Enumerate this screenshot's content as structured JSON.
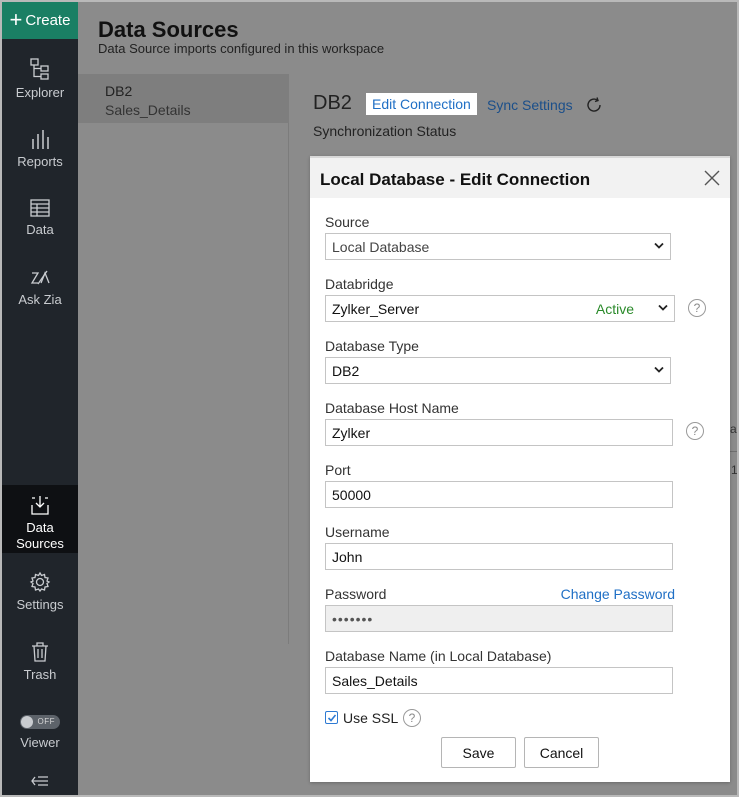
{
  "sidebar": {
    "create_label": "Create",
    "items": [
      {
        "label": "Explorer",
        "icon": "explorer-icon"
      },
      {
        "label": "Reports",
        "icon": "reports-icon"
      },
      {
        "label": "Data",
        "icon": "data-table-icon"
      },
      {
        "label": "Ask Zia",
        "icon": "ask-zia-icon"
      },
      {
        "label_line1": "Data",
        "label_line2": "Sources",
        "icon": "data-sources-icon",
        "active": true
      },
      {
        "label": "Settings",
        "icon": "gear-icon"
      },
      {
        "label": "Trash",
        "icon": "trash-icon"
      },
      {
        "label": "Viewer",
        "toggle_text": "OFF"
      }
    ],
    "collapse_icon": "collapse-icon"
  },
  "page": {
    "title": "Data Sources",
    "subtitle": "Data Source imports configured in this workspace",
    "list_item": {
      "name": "DB2",
      "sub": "Sales_Details"
    },
    "detail_title": "DB2",
    "edit_connection": "Edit Connection",
    "sync_settings": "Sync Settings",
    "sync_status": "Synchronization Status",
    "bg_fragment_1": "as",
    "bg_fragment_2": "1"
  },
  "dialog": {
    "title": "Local Database - Edit Connection",
    "source_label": "Source",
    "source_value": "Local Database",
    "databridge_label": "Databridge",
    "databridge_value": "Zylker_Server",
    "databridge_status": "Active",
    "dbtype_label": "Database Type",
    "dbtype_value": "DB2",
    "host_label": "Database Host Name",
    "host_value": "Zylker",
    "port_label": "Port",
    "port_value": "50000",
    "username_label": "Username",
    "username_value": "John",
    "password_label": "Password",
    "change_password": "Change Password",
    "password_value": "•••••••",
    "dbname_label": "Database Name (in Local Database)",
    "dbname_value": "Sales_Details",
    "use_ssl_label": "Use SSL",
    "use_ssl_checked": true,
    "help_glyph": "?",
    "save_label": "Save",
    "cancel_label": "Cancel"
  },
  "colors": {
    "sidebar_bg": "#20252b",
    "create_bg": "#1a7f64",
    "link": "#1f6fc5",
    "active_status": "#2a8a2a",
    "overlay": "#8b8b8b"
  }
}
